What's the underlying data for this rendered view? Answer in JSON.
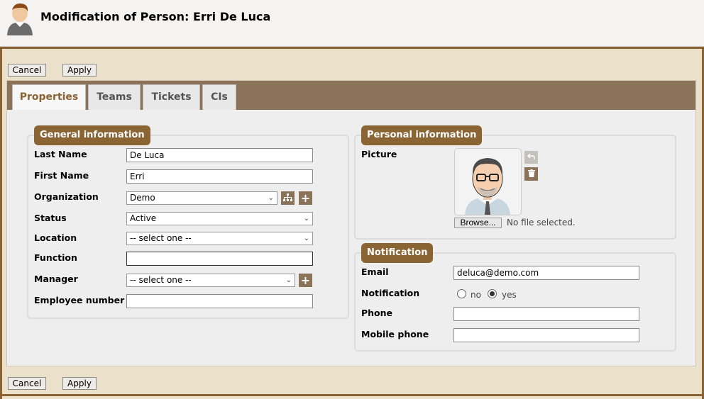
{
  "header": {
    "title": "Modification of Person: Erri De Luca",
    "icon": "person-icon"
  },
  "actions": {
    "cancel_label": "Cancel",
    "apply_label": "Apply"
  },
  "tabs": [
    {
      "label": "Properties",
      "active": true
    },
    {
      "label": "Teams",
      "active": false
    },
    {
      "label": "Tickets",
      "active": false
    },
    {
      "label": "CIs",
      "active": false
    }
  ],
  "general": {
    "legend": "General information",
    "last_name": {
      "label": "Last Name",
      "value": "De Luca"
    },
    "first_name": {
      "label": "First Name",
      "value": "Erri"
    },
    "organization": {
      "label": "Organization",
      "value": "Demo"
    },
    "status": {
      "label": "Status",
      "value": "Active"
    },
    "location": {
      "label": "Location",
      "value": "-- select one --"
    },
    "function": {
      "label": "Function",
      "value": ""
    },
    "manager": {
      "label": "Manager",
      "value": "-- select one --"
    },
    "employee_number": {
      "label": "Employee number",
      "value": ""
    }
  },
  "personal": {
    "legend": "Personal information",
    "picture_label": "Picture",
    "browse_label": "Browse...",
    "no_file_text": "No file selected."
  },
  "notification": {
    "legend": "Notification",
    "email": {
      "label": "Email",
      "value": "deluca@demo.com"
    },
    "notification": {
      "label": "Notification",
      "option_no": "no",
      "option_yes": "yes",
      "selected": "yes"
    },
    "phone": {
      "label": "Phone",
      "value": ""
    },
    "mobile_phone": {
      "label": "Mobile phone",
      "value": ""
    }
  },
  "colors": {
    "accent": "#8b6433",
    "tabbar": "#8a7358",
    "frame_bg": "#ebe0c9"
  }
}
